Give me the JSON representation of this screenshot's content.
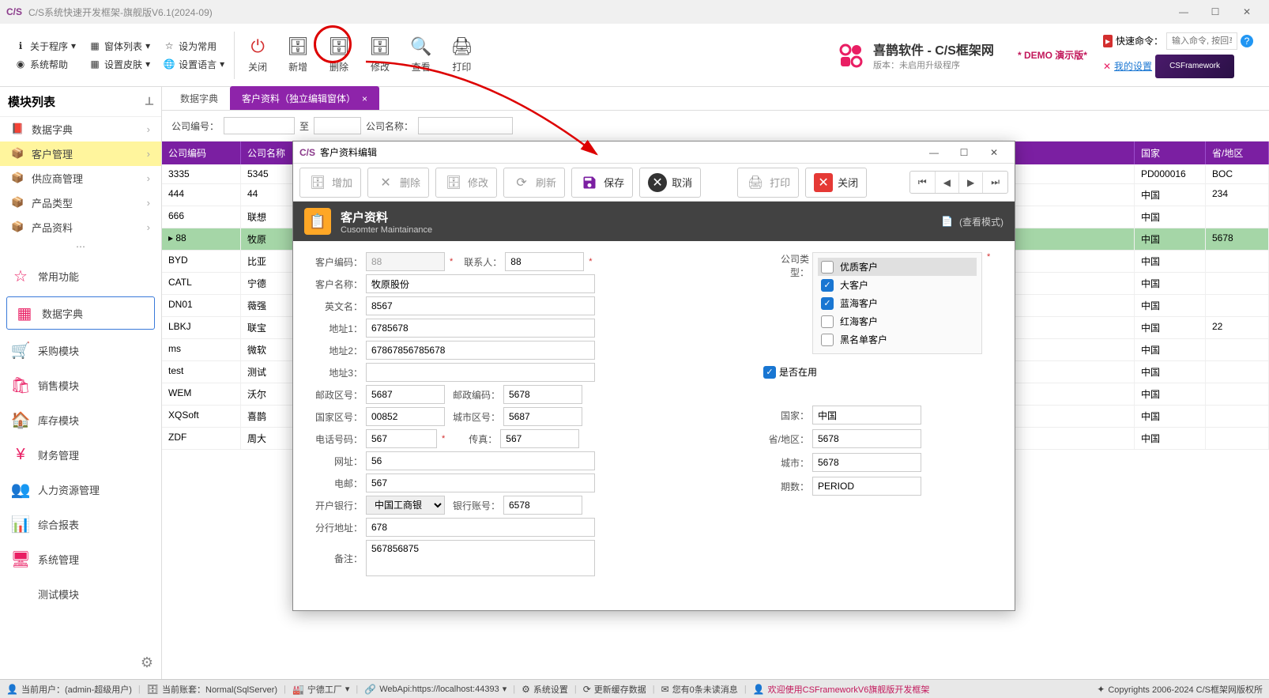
{
  "window": {
    "title": "C/S系统快速开发框架-旗舰版V6.1(2024-09)"
  },
  "toolbar_links": {
    "about": "关于程序",
    "windows": "窗体列表",
    "setdefault": "设为常用",
    "help": "系统帮助",
    "skin": "设置皮肤",
    "lang": "设置语言"
  },
  "big_buttons": {
    "close": "关闭",
    "add": "新增",
    "delete": "删除",
    "edit": "修改",
    "view": "查看",
    "print": "打印"
  },
  "brand": {
    "line1": "喜鹊软件 - C/S框架网",
    "line2": "版本：未启用升级程序",
    "demo": "* DEMO 演示版*"
  },
  "quick": {
    "label": "快速命令：",
    "placeholder": "输入命令, 按回车",
    "settings": "我的设置",
    "promo": "CSFramework"
  },
  "sidebar": {
    "title": "模块列表",
    "items": [
      {
        "label": "数据字典"
      },
      {
        "label": "客户管理",
        "active": true
      },
      {
        "label": "供应商管理"
      },
      {
        "label": "产品类型"
      },
      {
        "label": "产品资料"
      }
    ],
    "nav": [
      {
        "label": "常用功能"
      },
      {
        "label": "数据字典",
        "selected": true
      },
      {
        "label": "采购模块"
      },
      {
        "label": "销售模块"
      },
      {
        "label": "库存模块"
      },
      {
        "label": "财务管理"
      },
      {
        "label": "人力资源管理"
      },
      {
        "label": "综合报表"
      },
      {
        "label": "系统管理"
      },
      {
        "label": "测试模块"
      }
    ]
  },
  "tabs": [
    {
      "label": "数据字典"
    },
    {
      "label": "客户资料（独立编辑窗体）",
      "active": true
    }
  ],
  "filter": {
    "code": "公司编号：",
    "to": "至",
    "name": "公司名称："
  },
  "grid": {
    "cols": [
      "公司编码",
      "公司名称",
      "国家",
      "省/地区"
    ],
    "rows": [
      {
        "c1": "3335",
        "c2": "5345",
        "c3": "PD000016",
        "c4": "BOC"
      },
      {
        "c1": "444",
        "c2": "44",
        "c3": "中国",
        "c4": "234"
      },
      {
        "c1": "666",
        "c2": "联想",
        "c3": "中国",
        "c4": ""
      },
      {
        "c1": "88",
        "c2": "牧原",
        "c3": "中国",
        "c4": "5678",
        "sel": true
      },
      {
        "c1": "BYD",
        "c2": "比亚",
        "c3": "中国",
        "c4": ""
      },
      {
        "c1": "CATL",
        "c2": "宁德",
        "c3": "中国",
        "c4": ""
      },
      {
        "c1": "DN01",
        "c2": "薇强",
        "c3": "中国",
        "c4": ""
      },
      {
        "c1": "LBKJ",
        "c2": "联宝",
        "c3": "中国",
        "c4": "22"
      },
      {
        "c1": "ms",
        "c2": "微软",
        "c3": "中国",
        "c4": ""
      },
      {
        "c1": "test",
        "c2": "测试",
        "c3": "中国",
        "c4": ""
      },
      {
        "c1": "WEM",
        "c2": "沃尔",
        "c3": "中国",
        "c4": ""
      },
      {
        "c1": "XQSoft",
        "c2": "喜鹊",
        "c3": "中国",
        "c4": ""
      },
      {
        "c1": "ZDF",
        "c2": "周大",
        "c3": "中国",
        "c4": ""
      }
    ]
  },
  "modal": {
    "title": "客户资料编辑",
    "tb": {
      "add": "增加",
      "del": "删除",
      "edit": "修改",
      "refresh": "刷新",
      "save": "保存",
      "cancel": "取消",
      "print": "打印",
      "close": "关闭"
    },
    "banner": {
      "title": "客户资料",
      "sub": "Cusomter Maintainance",
      "mode": "(查看模式)"
    },
    "form": {
      "code_l": "客户编码：",
      "code": "88",
      "contact_l": "联系人：",
      "contact": "88",
      "name_l": "客户名称：",
      "name": "牧原股份",
      "en_l": "英文名：",
      "en": "8567",
      "addr1_l": "地址1：",
      "addr1": "6785678",
      "addr2_l": "地址2：",
      "addr2": "67867856785678",
      "addr3_l": "地址3：",
      "addr3": "",
      "zip_area_l": "邮政区号：",
      "zip_area": "5687",
      "zip_l": "邮政编码：",
      "zip": "5678",
      "ccode_l": "国家区号：",
      "ccode": "00852",
      "city_code_l": "城市区号：",
      "city_code": "5687",
      "tel_l": "电话号码：",
      "tel": "567",
      "fax_l": "传真：",
      "fax": "567",
      "url_l": "网址：",
      "url": "56",
      "email_l": "电邮：",
      "email": "567",
      "bank_l": "开户银行：",
      "bank": "中国工商银",
      "account_l": "银行账号：",
      "account": "6578",
      "branch_l": "分行地址：",
      "branch": "678",
      "remark_l": "备注：",
      "remark": "567856875"
    },
    "types_l": "公司类型：",
    "types": [
      {
        "label": "优质客户",
        "on": false,
        "sel": true
      },
      {
        "label": "大客户",
        "on": true
      },
      {
        "label": "蓝海客户",
        "on": true
      },
      {
        "label": "红海客户",
        "on": false
      },
      {
        "label": "黑名单客户",
        "on": false
      }
    ],
    "inuse_l": "是否在用",
    "r": {
      "country_l": "国家：",
      "country": "中国",
      "prov_l": "省/地区：",
      "prov": "5678",
      "city_l": "城市：",
      "city": "5678",
      "period_l": "期数：",
      "period": "PERIOD"
    }
  },
  "status": {
    "user": "当前用户：(admin-超级用户)",
    "acct": "当前账套：Normal(SqlServer)",
    "factory": "宁德工厂",
    "api": "WebApi:https://localhost:44393",
    "sys": "系统设置",
    "cache": "更新缓存数据",
    "msg": "您有0条未读消息",
    "welcome": "欢迎使用CSFrameworkV6旗舰版开发框架",
    "copy": "Copyrights 2006-2024 C/S框架网版权所"
  }
}
